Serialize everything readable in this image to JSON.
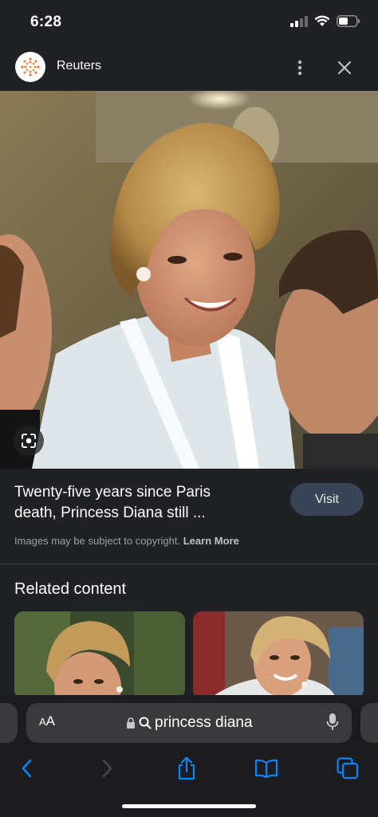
{
  "status": {
    "time": "6:28"
  },
  "source": {
    "name": "Reuters",
    "logo_icon": "reuters-logo"
  },
  "image": {
    "alt_icon": "lens-icon"
  },
  "result": {
    "title_line1": "Twenty-five years since Paris",
    "title_line2": "death, Princess Diana still ...",
    "visit_label": "Visit",
    "copyright_text": "Images may be subject to copyright.",
    "learn_more": "Learn More"
  },
  "related": {
    "title": "Related content"
  },
  "browser": {
    "aa_label_big": "A",
    "aa_label_small": "A",
    "url_text": "princess diana"
  },
  "colors": {
    "background": "#202124",
    "visit_button": "#394457",
    "accent_blue": "#0a84ff"
  }
}
